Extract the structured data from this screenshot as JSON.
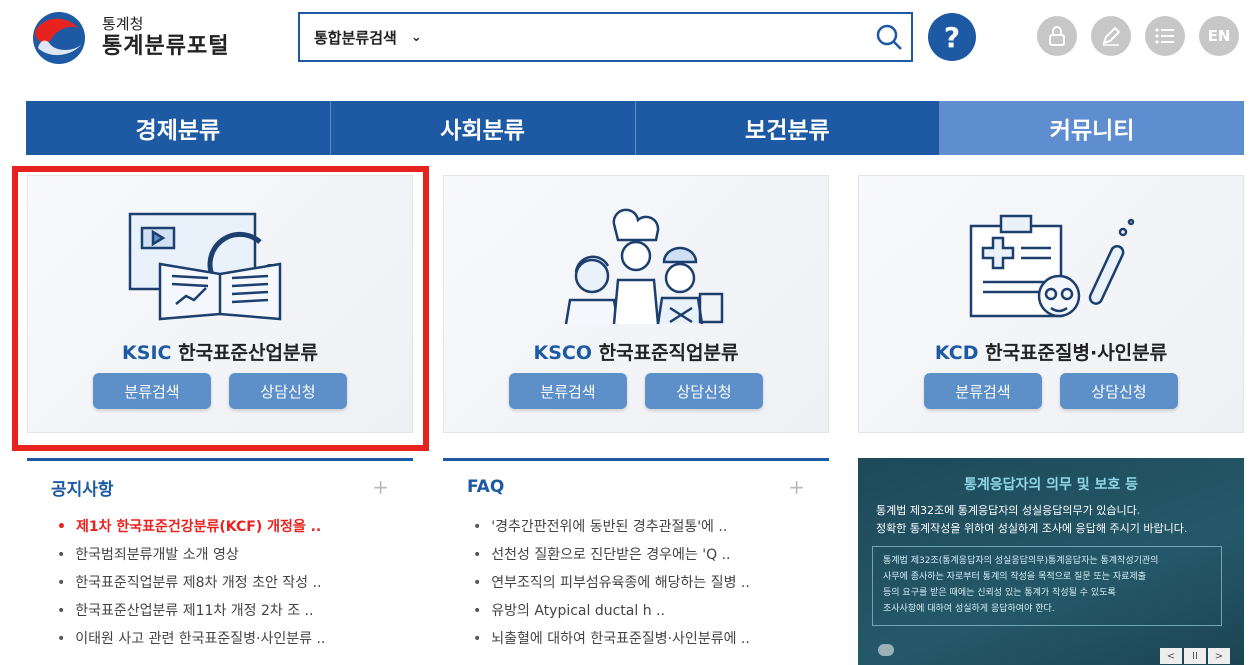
{
  "header": {
    "logo_small": "통계청",
    "logo_big": "통계분류포털",
    "search_scope": "통합분류검색",
    "search_value": "",
    "help_label": "?",
    "lang_label": "EN"
  },
  "nav": {
    "items": [
      {
        "label": "경제분류"
      },
      {
        "label": "사회분류"
      },
      {
        "label": "보건분류"
      },
      {
        "label": "커뮤니티"
      }
    ]
  },
  "cards": [
    {
      "code": "KSIC",
      "name": "한국표준산업분류",
      "btn_search": "분류검색",
      "btn_consult": "상담신청"
    },
    {
      "code": "KSCO",
      "name": "한국표준직업분류",
      "btn_search": "분류검색",
      "btn_consult": "상담신청"
    },
    {
      "code": "KCD",
      "name": "한국표준질병·사인분류",
      "btn_search": "분류검색",
      "btn_consult": "상담신청"
    }
  ],
  "notice": {
    "title": "공지사항",
    "plus": "+",
    "items": [
      "제1차 한국표준건강분류(KCF) 개정을 ..",
      "한국범죄분류개발 소개 영상",
      "한국표준직업분류 제8차 개정 초안 작성 ..",
      "한국표준산업분류 제11차 개정 2차 조 ..",
      "이태원 사고 관련 한국표준질병·사인분류 .."
    ]
  },
  "faq": {
    "title": "FAQ",
    "plus": "+",
    "items": [
      "'경추간판전위에 동반된 경추관절통'에 ..",
      "선천성 질환으로 진단받은 경우에는 'Q ..",
      "연부조직의 피부섬유육종에 해당하는 질병 ..",
      "유방의 Atypical ductal h ..",
      "뇌출혈에 대하여 한국표준질병·사인분류에 .."
    ]
  },
  "banner": {
    "title": "통계응답자의 의무 및 보호 등",
    "line1": "통계법 제32조에 통계응답자의 성실응답의무가 있습니다.",
    "line2": "정확한 통계작성을 위하여 성실하게 조사에 응답해 주시기 바랍니다.",
    "box_line1": "통계법 제32조(통계응답자의 성실응답의무)통계응답자는 통계작성기관의",
    "box_line2": "사무에 종사하는 자로부터 통계의 작성을 목적으로 질문 또는 자료제출",
    "box_line3": "등의 요구를 받은 때에는 신뢰성 있는 통계가 작성될 수 있도록",
    "box_line4": "조사사항에 대하여 성실하게 응답하여야 한다.",
    "ctrl_prev": "<",
    "ctrl_pause": "II",
    "ctrl_next": ">"
  }
}
